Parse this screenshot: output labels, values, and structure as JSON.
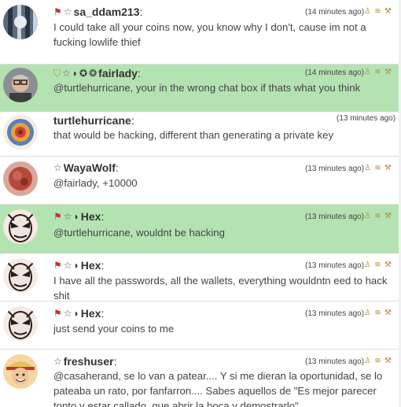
{
  "colors": {
    "highlight": "#b3e3b1",
    "separator": "#dedede",
    "text": "#444444"
  },
  "messages": [
    {
      "username": "sa_ddam213",
      "time": "(14 minutes ago)",
      "text": "I could take all your coins now, you know why I don't, cause im not a fucking lowlife thief",
      "badges": [
        "flag-icon",
        "star-outline-icon"
      ],
      "highlighted": false
    },
    {
      "username": "fairlady",
      "time": "(14 minutes ago)",
      "text": "@turtlehurricane,  your in the wrong chat box if thats what you think",
      "badges": [
        "shield-icon",
        "star-outline-icon",
        "bird-icon",
        "ribbon-icon",
        "bear-icon"
      ],
      "highlighted": true
    },
    {
      "username": "turtlehurricane",
      "time": "(13 minutes ago)",
      "text": "that would be hacking, different than generating a private key",
      "badges": [],
      "highlighted": false
    },
    {
      "username": "WayaWolf",
      "time": "(13 minutes ago)",
      "text": "@fairlady, +10000",
      "badges": [
        "star-outline-icon"
      ],
      "highlighted": false
    },
    {
      "username": "Hex",
      "time": "(13 minutes ago)",
      "text": "@turtlehurricane, wouldnt be hacking",
      "badges": [
        "flag-icon",
        "star-outline-icon",
        "bird-icon"
      ],
      "highlighted": true
    },
    {
      "username": "Hex",
      "time": "(13 minutes ago)",
      "text": "I have all the passwords, all the wallets, everything wouldntn eed to hack shit",
      "badges": [
        "flag-icon",
        "star-outline-icon",
        "bird-icon"
      ],
      "highlighted": false
    },
    {
      "username": "Hex",
      "time": "(13 minutes ago)",
      "text": "just send your coins to me",
      "badges": [
        "flag-icon",
        "star-outline-icon",
        "bird-icon"
      ],
      "highlighted": false
    },
    {
      "username": "freshuser",
      "time": "(13 minutes ago)",
      "text": "@casaherand,  se lo van a patear.... Y si me dieran la oportunidad, se lo pateaba un rato, por fanfarron.... Sabes aquellos de \"Es mejor parecer tonto y estar callado, que abrir la boca y demostrarlo\"",
      "badges": [
        "star-outline-icon"
      ],
      "highlighted": false
    }
  ],
  "colon": ":"
}
